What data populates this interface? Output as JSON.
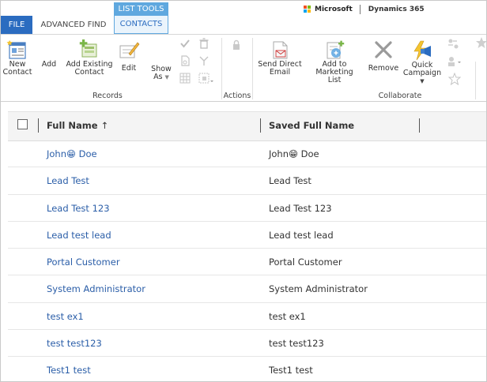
{
  "tabs": {
    "file": "FILE",
    "advanced_find": "ADVANCED FIND",
    "context_group": "LIST TOOLS",
    "contacts": "CONTACTS"
  },
  "brand": {
    "microsoft": "Microsoft",
    "product": "Dynamics 365",
    "logo_colors": [
      "#f25022",
      "#7fba00",
      "#00a4ef",
      "#ffb900"
    ]
  },
  "ribbon": {
    "records": {
      "label": "Records",
      "new_contact": [
        "New",
        "Contact"
      ],
      "add": "Add",
      "add_existing": [
        "Add Existing",
        "Contact"
      ],
      "edit": "Edit",
      "show_as": [
        "Show",
        "As"
      ]
    },
    "actions": {
      "label": "Actions"
    },
    "collaborate": {
      "label": "Collaborate",
      "send_direct_email": [
        "Send Direct",
        "Email"
      ],
      "add_to_marketing": [
        "Add to Marketing",
        "List"
      ],
      "remove": "Remove",
      "quick_campaign": [
        "Quick",
        "Campaign"
      ]
    }
  },
  "grid": {
    "columns": [
      "Full Name",
      "Saved Full Name"
    ],
    "sort_indicator": "↑",
    "rows": [
      {
        "full_name": "John😁 Doe",
        "saved_full_name": "John😁 Doe"
      },
      {
        "full_name": "Lead Test",
        "saved_full_name": "Lead Test"
      },
      {
        "full_name": "Lead Test 123",
        "saved_full_name": "Lead Test 123"
      },
      {
        "full_name": "Lead test lead",
        "saved_full_name": "Lead test lead"
      },
      {
        "full_name": "Portal Customer",
        "saved_full_name": "Portal Customer"
      },
      {
        "full_name": "System Administrator",
        "saved_full_name": "System Administrator"
      },
      {
        "full_name": "test ex1",
        "saved_full_name": "test ex1"
      },
      {
        "full_name": "test test123",
        "saved_full_name": "test test123"
      },
      {
        "full_name": "Test1 test",
        "saved_full_name": "Test1 test"
      }
    ]
  },
  "colors": {
    "accent": "#2b6cc0",
    "context_tab": "#5fa8df",
    "link": "#2b5ea8"
  }
}
